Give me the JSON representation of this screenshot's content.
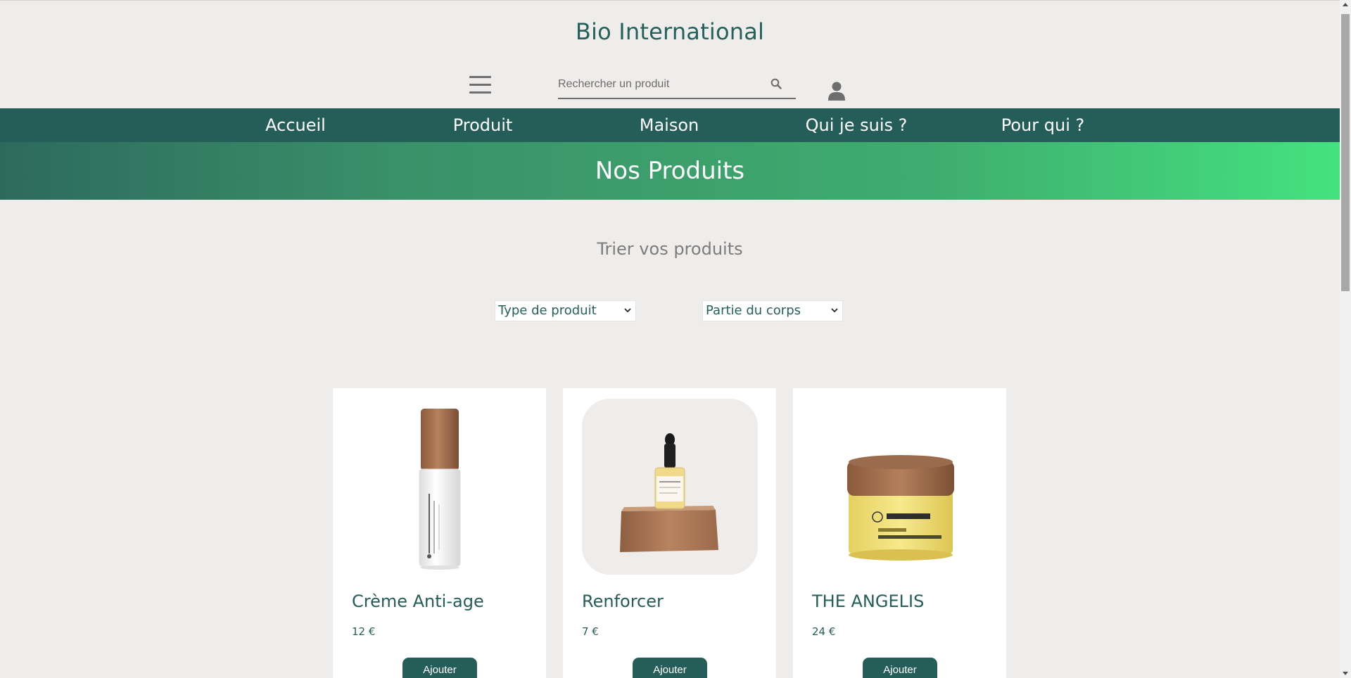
{
  "header": {
    "site_title": "Bio International",
    "search_placeholder": "Rechercher un produit",
    "icons": {
      "menu": "hamburger-menu-icon",
      "search": "search-icon",
      "account": "user-icon"
    }
  },
  "nav": {
    "items": [
      {
        "label": "Accueil"
      },
      {
        "label": "Produit"
      },
      {
        "label": "Maison"
      },
      {
        "label": "Qui je suis ?"
      },
      {
        "label": "Pour qui ?"
      }
    ]
  },
  "banner": {
    "title": "Nos Produits"
  },
  "filters": {
    "title": "Trier vos produits",
    "type_select": "Type de produit",
    "body_select": "Partie du corps"
  },
  "products": [
    {
      "name": "Crème Anti-age",
      "price": "12 €",
      "button": "Ajouter",
      "image_icon": "serum-bottle-image"
    },
    {
      "name": "Renforcer",
      "price": "7 €",
      "button": "Ajouter",
      "image_icon": "dropper-bottle-image"
    },
    {
      "name": "THE ANGELIS",
      "price": "24 €",
      "button": "Ajouter",
      "image_icon": "balm-jar-image"
    }
  ],
  "colors": {
    "primary": "#255e58",
    "background": "#efedeb",
    "banner_start": "#2d6a5e",
    "banner_end": "#44e27f",
    "muted_text": "#7c7c7c"
  }
}
